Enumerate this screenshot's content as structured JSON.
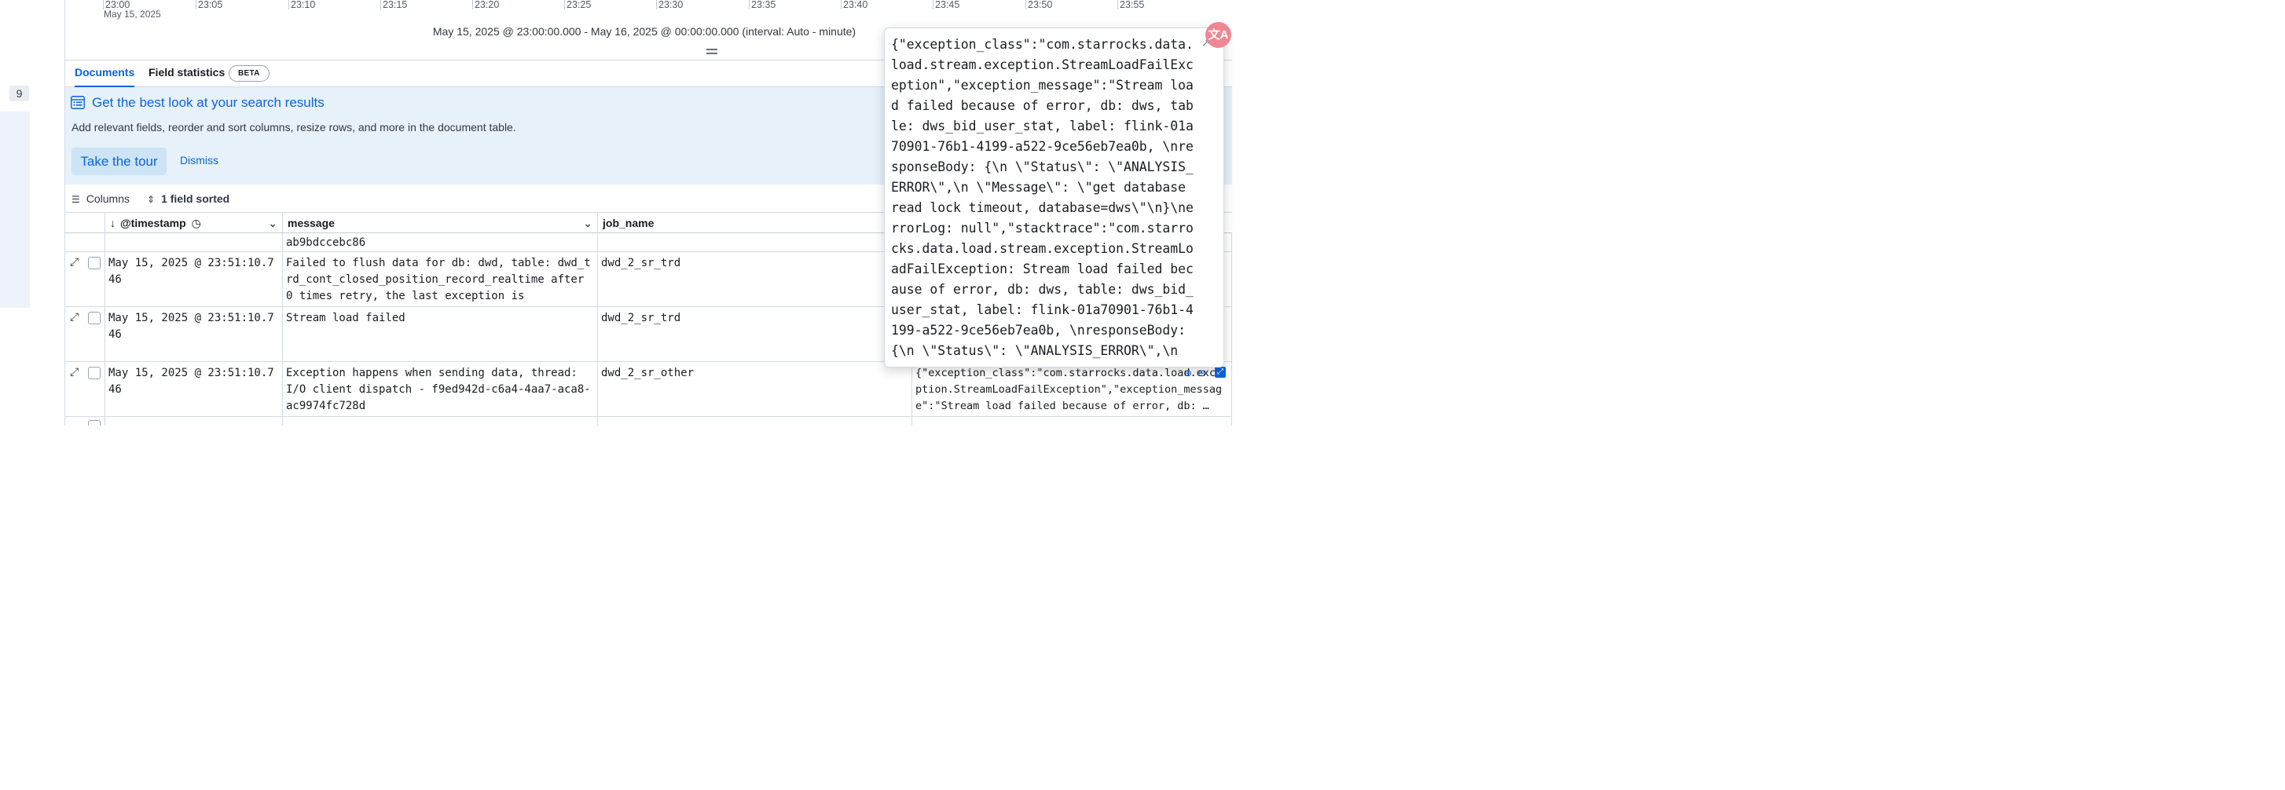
{
  "sidebar": {
    "count_badge": "9"
  },
  "timeline": {
    "ticks": [
      "23:00",
      "23:05",
      "23:10",
      "23:15",
      "23:20",
      "23:25",
      "23:30",
      "23:35",
      "23:40",
      "23:45",
      "23:50",
      "23:55"
    ],
    "first_tick_date": "May 15, 2025",
    "range_label": "May 15, 2025 @ 23:00:00.000 - May 16, 2025 @ 00:00:00.000 (interval: Auto - minute)"
  },
  "tabs": {
    "documents": "Documents",
    "field_statistics": "Field statistics",
    "beta_badge": "BETA"
  },
  "callout": {
    "title": "Get the best look at your search results",
    "body": "Add relevant fields, reorder and sort columns, resize rows, and more in the document table.",
    "tour_button": "Take the tour",
    "dismiss_button": "Dismiss"
  },
  "toolbar": {
    "columns_label": "Columns",
    "sort_label": "1 field sorted"
  },
  "table": {
    "headers": {
      "timestamp": "@timestamp",
      "message": "message",
      "job_name": "job_name"
    },
    "partial_row": {
      "message": "ab9bdccebc86"
    },
    "rows": [
      {
        "timestamp": "May 15, 2025 @ 23:51:10.746",
        "message": "Failed to flush data for db: dwd, table: dwd_trd_cont_closed_position_record_realtime after 0 times retry, the last exception is",
        "job_name": "dwd_2_sr_trd",
        "last": ""
      },
      {
        "timestamp": "May 15, 2025 @ 23:51:10.746",
        "message": "Stream load failed",
        "job_name": "dwd_2_sr_trd",
        "last": ""
      },
      {
        "timestamp": "May 15, 2025 @ 23:51:10.746",
        "message": "Exception happens when sending data, thread: I/O client dispatch - f9ed942d-c6a4-4aa7-aca8-ac9974fc728d",
        "job_name": "dwd_2_sr_other",
        "last": "{\"exception_class\":\"com.starrocks.data.load.exception.StreamLoadFailException\",\"exception_message\":\"Stream load failed because of error, db: …"
      }
    ]
  },
  "popover": {
    "text": "{\"exception_class\":\"com.starrocks.data.load.stream.exception.StreamLoadFailException\",\"exception_message\":\"Stream load failed because of error, db: dws, table: dws_bid_user_stat, label: flink-01a70901-76b1-4199-a522-9ce56eb7ea0b, \\nresponseBody: {\\n \\\"Status\\\": \\\"ANALYSIS_ERROR\\\",\\n \\\"Message\\\": \\\"get database read lock timeout, database=dws\\\"\\n}\\nerrorLog: null\",\"stacktrace\":\"com.starrocks.data.load.stream.exception.StreamLoadFailException: Stream load failed because of error, db: dws, table: dws_bid_user_stat, label: flink-01a70901-76b1-4199-a522-9ce56eb7ea0b, \\nresponseBody: {\\n \\\"Status\\\": \\\"ANALYSIS_ERROR\\\",\\n"
  },
  "translate_button": "文A",
  "colors": {
    "accent": "#0b64dd",
    "callout_bg": "#e6f1fa",
    "fab": "#ee8792"
  }
}
